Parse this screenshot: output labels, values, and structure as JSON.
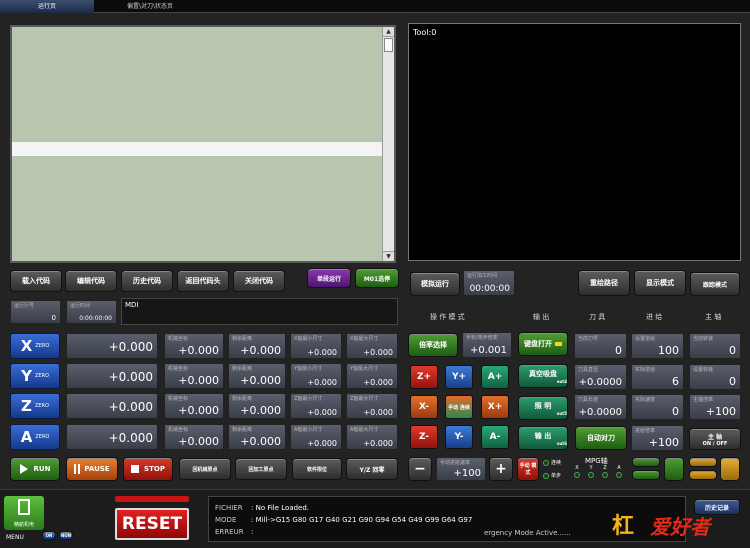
{
  "tabs": [
    "运行页",
    "偏置\\对刀\\状态页"
  ],
  "tool_label": "Tool:0",
  "code_buttons": [
    "载入代码",
    "编辑代码",
    "历史代码",
    "返回代码头",
    "关闭代码"
  ],
  "single_run": "单段运行",
  "m01": "M01选停",
  "line_label": "运行行号",
  "line_value": "0",
  "time_label": "运行时间",
  "time_value": "0:00:00:00",
  "mdi_label": "MDI",
  "sim_run": "模拟运行",
  "sim_time_label": "运行加工时间",
  "sim_time_value": "00:00:00",
  "redraw_path": "重绘路径",
  "display_mode": "显示模式",
  "trace_mode": "跟踪模式",
  "headers": {
    "op": "操 作 模 式",
    "out": "输 出",
    "tool": "刀 具",
    "feed": "进 给",
    "spindle": "主 轴"
  },
  "axes": [
    {
      "name": "X",
      "zero": "ZERO",
      "pos": "+0.000",
      "f1": "机械坐标",
      "v1": "+0.000",
      "f2": "剩余距离",
      "v2": "+0.000",
      "f3": "X轴最小尺寸",
      "v3": "+0.000",
      "f4": "X轴最大尺寸",
      "v4": "+0.000"
    },
    {
      "name": "Y",
      "zero": "ZERO",
      "pos": "+0.000",
      "f1": "机械坐标",
      "v1": "+0.000",
      "f2": "剩余距离",
      "v2": "+0.000",
      "f3": "Y轴最小尺寸",
      "v3": "+0.000",
      "f4": "Y轴最大尺寸",
      "v4": "+0.000"
    },
    {
      "name": "Z",
      "zero": "ZERO",
      "pos": "+0.000",
      "f1": "机械坐标",
      "v1": "+0.000",
      "f2": "剩余距离",
      "v2": "+0.000",
      "f3": "Z轴最小尺寸",
      "v3": "+0.000",
      "f4": "Z轴最大尺寸",
      "v4": "+0.000"
    },
    {
      "name": "A",
      "zero": "ZERO",
      "pos": "+0.000",
      "f1": "机械坐标",
      "v1": "+0.000",
      "f2": "剩余距离",
      "v2": "+0.000",
      "f3": "A轴最小尺寸",
      "v3": "+0.000",
      "f4": "A轴最大尺寸",
      "v4": "+0.000"
    }
  ],
  "rate_select": "倍率选择",
  "step_label": "手轮/单步倍率",
  "step_value": "+0.001",
  "jog": {
    "zp": "Z+",
    "yp": "Y+",
    "ap": "A+",
    "xm": "X-",
    "mid": "手动 连续",
    "xp": "X+",
    "zm": "Z-",
    "ym": "Y-",
    "am": "A-"
  },
  "outputs": [
    {
      "label": "键盘打开",
      "sub": ""
    },
    {
      "label": "真空吸盘",
      "sub": "out4"
    },
    {
      "label": "照 明",
      "sub": "out5"
    },
    {
      "label": "输 出",
      "sub": "out6"
    }
  ],
  "tool_fields": [
    {
      "label": "当前刀号",
      "value": "0"
    },
    {
      "label": "刀具直径",
      "value": "+0.0000"
    },
    {
      "label": "刀具长度",
      "value": "+0.0000"
    }
  ],
  "auto_tool": "自动对刀",
  "feed_fields": [
    {
      "label": "设置进给",
      "value": "100"
    },
    {
      "label": "实际进给",
      "value": "6"
    },
    {
      "label": "实际速度",
      "value": "0"
    },
    {
      "label": "进给倍率",
      "value": "+100"
    }
  ],
  "spindle_fields": [
    {
      "label": "当前转速",
      "value": "0"
    },
    {
      "label": "设置转速",
      "value": "0"
    },
    {
      "label": "主轴倍率",
      "value": "+100"
    }
  ],
  "spindle_btn": {
    "top": "主 轴",
    "bottom": "ON / OFF"
  },
  "run": "RUN",
  "pause": "PAUSE",
  "stop": "STOP",
  "machine_origin": "回机械原点",
  "work_origin": "回加工原点",
  "soft_limit": "软件限位",
  "yz_zero": "Y/Z 回零",
  "jog_rate_label": "手动进给速率",
  "jog_rate_value": "+100",
  "minus": "−",
  "plus": "+",
  "manual_mode": "手动 模式",
  "cont": "连续",
  "single": "单步",
  "mpg_title": "MPG轴",
  "mpg_axes": [
    "X",
    "Y",
    "Z",
    "A"
  ],
  "menu": "MENU",
  "menu_on": "ON",
  "menu_off": "NON",
  "logo_text": "精航机电",
  "reset": "RESET",
  "status_rows": [
    {
      "k": "FICHIER",
      "v": ": No File Loaded."
    },
    {
      "k": "MODE",
      "v": ": Mill->G15  G80 G17 G40 G21 G90 G94 G54 G49 G99 G64 G97"
    },
    {
      "k": "ERREUR",
      "v": ":"
    }
  ],
  "emergency": "ergency Mode Active......",
  "history": "历史记录",
  "brand": "爱好者",
  "colors": {
    "accent_green": "#3fa02a",
    "accent_blue": "#2c6ccc",
    "reset_red": "#c81414"
  }
}
